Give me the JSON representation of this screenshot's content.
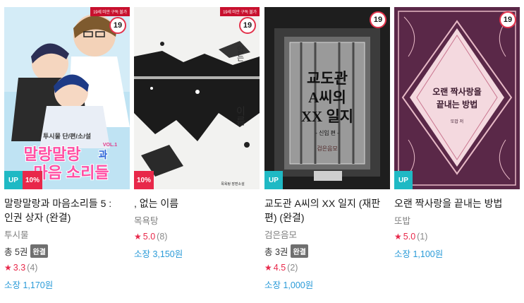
{
  "badges": {
    "age": "19",
    "age_notice": "19세 미만 구독 불가",
    "up": "UP",
    "complete": "완결"
  },
  "books": [
    {
      "title": "말랑말랑과 마음소리들 5 : 인권 상자 (완결)",
      "author": "투시물",
      "volumes": "총 5권",
      "complete": true,
      "rating": "3.3",
      "rating_count": "(4)",
      "price": "소장 1,170원",
      "discount": "10%",
      "up": true,
      "age_notice": true,
      "cover_text": {
        "sub": "투시물 단/편/소/설",
        "main1": "말랑말랑",
        "main2": "마음 소리들",
        "vol": "VOL.1",
        "conj": "과"
      },
      "colors": {
        "bg": "#bfe3f3",
        "accent": "#ff4fa3"
      }
    },
    {
      "title": ", 없는 이름",
      "author": "목욕탕",
      "volumes": "",
      "complete": false,
      "rating": "5.0",
      "rating_count": "(8)",
      "price": "소장 3,150원",
      "discount": "10%",
      "up": false,
      "age_notice": true,
      "cover_text": {
        "top": "없는",
        "main": "이름",
        "foot": "목욕탕 장편소설"
      },
      "colors": {
        "bg": "#f2f2f0",
        "ink": "#1b1b1b"
      }
    },
    {
      "title": "교도관 A씨의 XX 일지 (재판 편) (완결)",
      "author": "검은음모",
      "volumes": "총 3권",
      "complete": true,
      "rating": "4.5",
      "rating_count": "(2)",
      "price": "소장 1,000원",
      "discount": "",
      "up": true,
      "age_notice": false,
      "cover_text": {
        "line1": "교도관",
        "line2": "A씨의",
        "line3": "XX 일지",
        "sub": "- 신입 편 -",
        "author_plate": "검은음모"
      },
      "colors": {
        "bg": "#2a2a2a"
      }
    },
    {
      "title": "오랜 짝사랑을 끝내는 방법",
      "author": "또밥",
      "volumes": "",
      "complete": false,
      "rating": "5.0",
      "rating_count": "(1)",
      "price": "소장 1,100원",
      "discount": "",
      "up": true,
      "age_notice": false,
      "cover_text": {
        "line1": "오랜 짝사랑을",
        "line2": "끝내는 방법",
        "author": "또밥 저"
      },
      "colors": {
        "bg": "#5a2848",
        "panel": "#f4d9df"
      }
    }
  ]
}
